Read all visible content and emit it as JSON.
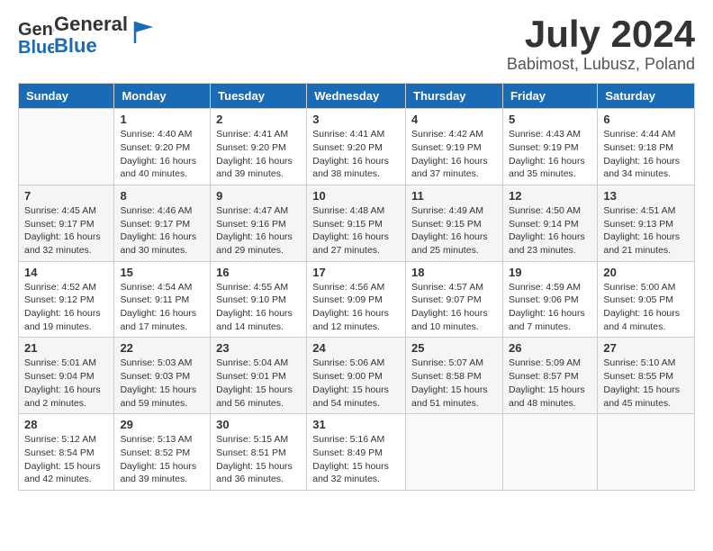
{
  "header": {
    "logo_general": "General",
    "logo_blue": "Blue",
    "month_year": "July 2024",
    "location": "Babimost, Lubusz, Poland"
  },
  "days_of_week": [
    "Sunday",
    "Monday",
    "Tuesday",
    "Wednesday",
    "Thursday",
    "Friday",
    "Saturday"
  ],
  "weeks": [
    [
      {
        "num": "",
        "sunrise": "",
        "sunset": "",
        "daylight": "",
        "empty": true
      },
      {
        "num": "1",
        "sunrise": "Sunrise: 4:40 AM",
        "sunset": "Sunset: 9:20 PM",
        "daylight": "Daylight: 16 hours and 40 minutes.",
        "empty": false
      },
      {
        "num": "2",
        "sunrise": "Sunrise: 4:41 AM",
        "sunset": "Sunset: 9:20 PM",
        "daylight": "Daylight: 16 hours and 39 minutes.",
        "empty": false
      },
      {
        "num": "3",
        "sunrise": "Sunrise: 4:41 AM",
        "sunset": "Sunset: 9:20 PM",
        "daylight": "Daylight: 16 hours and 38 minutes.",
        "empty": false
      },
      {
        "num": "4",
        "sunrise": "Sunrise: 4:42 AM",
        "sunset": "Sunset: 9:19 PM",
        "daylight": "Daylight: 16 hours and 37 minutes.",
        "empty": false
      },
      {
        "num": "5",
        "sunrise": "Sunrise: 4:43 AM",
        "sunset": "Sunset: 9:19 PM",
        "daylight": "Daylight: 16 hours and 35 minutes.",
        "empty": false
      },
      {
        "num": "6",
        "sunrise": "Sunrise: 4:44 AM",
        "sunset": "Sunset: 9:18 PM",
        "daylight": "Daylight: 16 hours and 34 minutes.",
        "empty": false
      }
    ],
    [
      {
        "num": "7",
        "sunrise": "Sunrise: 4:45 AM",
        "sunset": "Sunset: 9:17 PM",
        "daylight": "Daylight: 16 hours and 32 minutes.",
        "empty": false
      },
      {
        "num": "8",
        "sunrise": "Sunrise: 4:46 AM",
        "sunset": "Sunset: 9:17 PM",
        "daylight": "Daylight: 16 hours and 30 minutes.",
        "empty": false
      },
      {
        "num": "9",
        "sunrise": "Sunrise: 4:47 AM",
        "sunset": "Sunset: 9:16 PM",
        "daylight": "Daylight: 16 hours and 29 minutes.",
        "empty": false
      },
      {
        "num": "10",
        "sunrise": "Sunrise: 4:48 AM",
        "sunset": "Sunset: 9:15 PM",
        "daylight": "Daylight: 16 hours and 27 minutes.",
        "empty": false
      },
      {
        "num": "11",
        "sunrise": "Sunrise: 4:49 AM",
        "sunset": "Sunset: 9:15 PM",
        "daylight": "Daylight: 16 hours and 25 minutes.",
        "empty": false
      },
      {
        "num": "12",
        "sunrise": "Sunrise: 4:50 AM",
        "sunset": "Sunset: 9:14 PM",
        "daylight": "Daylight: 16 hours and 23 minutes.",
        "empty": false
      },
      {
        "num": "13",
        "sunrise": "Sunrise: 4:51 AM",
        "sunset": "Sunset: 9:13 PM",
        "daylight": "Daylight: 16 hours and 21 minutes.",
        "empty": false
      }
    ],
    [
      {
        "num": "14",
        "sunrise": "Sunrise: 4:52 AM",
        "sunset": "Sunset: 9:12 PM",
        "daylight": "Daylight: 16 hours and 19 minutes.",
        "empty": false
      },
      {
        "num": "15",
        "sunrise": "Sunrise: 4:54 AM",
        "sunset": "Sunset: 9:11 PM",
        "daylight": "Daylight: 16 hours and 17 minutes.",
        "empty": false
      },
      {
        "num": "16",
        "sunrise": "Sunrise: 4:55 AM",
        "sunset": "Sunset: 9:10 PM",
        "daylight": "Daylight: 16 hours and 14 minutes.",
        "empty": false
      },
      {
        "num": "17",
        "sunrise": "Sunrise: 4:56 AM",
        "sunset": "Sunset: 9:09 PM",
        "daylight": "Daylight: 16 hours and 12 minutes.",
        "empty": false
      },
      {
        "num": "18",
        "sunrise": "Sunrise: 4:57 AM",
        "sunset": "Sunset: 9:07 PM",
        "daylight": "Daylight: 16 hours and 10 minutes.",
        "empty": false
      },
      {
        "num": "19",
        "sunrise": "Sunrise: 4:59 AM",
        "sunset": "Sunset: 9:06 PM",
        "daylight": "Daylight: 16 hours and 7 minutes.",
        "empty": false
      },
      {
        "num": "20",
        "sunrise": "Sunrise: 5:00 AM",
        "sunset": "Sunset: 9:05 PM",
        "daylight": "Daylight: 16 hours and 4 minutes.",
        "empty": false
      }
    ],
    [
      {
        "num": "21",
        "sunrise": "Sunrise: 5:01 AM",
        "sunset": "Sunset: 9:04 PM",
        "daylight": "Daylight: 16 hours and 2 minutes.",
        "empty": false
      },
      {
        "num": "22",
        "sunrise": "Sunrise: 5:03 AM",
        "sunset": "Sunset: 9:03 PM",
        "daylight": "Daylight: 15 hours and 59 minutes.",
        "empty": false
      },
      {
        "num": "23",
        "sunrise": "Sunrise: 5:04 AM",
        "sunset": "Sunset: 9:01 PM",
        "daylight": "Daylight: 15 hours and 56 minutes.",
        "empty": false
      },
      {
        "num": "24",
        "sunrise": "Sunrise: 5:06 AM",
        "sunset": "Sunset: 9:00 PM",
        "daylight": "Daylight: 15 hours and 54 minutes.",
        "empty": false
      },
      {
        "num": "25",
        "sunrise": "Sunrise: 5:07 AM",
        "sunset": "Sunset: 8:58 PM",
        "daylight": "Daylight: 15 hours and 51 minutes.",
        "empty": false
      },
      {
        "num": "26",
        "sunrise": "Sunrise: 5:09 AM",
        "sunset": "Sunset: 8:57 PM",
        "daylight": "Daylight: 15 hours and 48 minutes.",
        "empty": false
      },
      {
        "num": "27",
        "sunrise": "Sunrise: 5:10 AM",
        "sunset": "Sunset: 8:55 PM",
        "daylight": "Daylight: 15 hours and 45 minutes.",
        "empty": false
      }
    ],
    [
      {
        "num": "28",
        "sunrise": "Sunrise: 5:12 AM",
        "sunset": "Sunset: 8:54 PM",
        "daylight": "Daylight: 15 hours and 42 minutes.",
        "empty": false
      },
      {
        "num": "29",
        "sunrise": "Sunrise: 5:13 AM",
        "sunset": "Sunset: 8:52 PM",
        "daylight": "Daylight: 15 hours and 39 minutes.",
        "empty": false
      },
      {
        "num": "30",
        "sunrise": "Sunrise: 5:15 AM",
        "sunset": "Sunset: 8:51 PM",
        "daylight": "Daylight: 15 hours and 36 minutes.",
        "empty": false
      },
      {
        "num": "31",
        "sunrise": "Sunrise: 5:16 AM",
        "sunset": "Sunset: 8:49 PM",
        "daylight": "Daylight: 15 hours and 32 minutes.",
        "empty": false
      },
      {
        "num": "",
        "sunrise": "",
        "sunset": "",
        "daylight": "",
        "empty": true
      },
      {
        "num": "",
        "sunrise": "",
        "sunset": "",
        "daylight": "",
        "empty": true
      },
      {
        "num": "",
        "sunrise": "",
        "sunset": "",
        "daylight": "",
        "empty": true
      }
    ]
  ]
}
